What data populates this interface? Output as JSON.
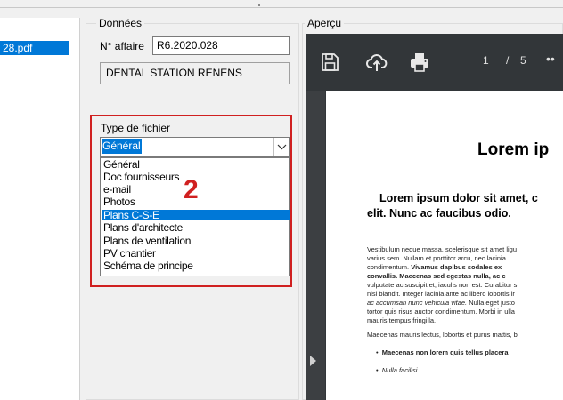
{
  "file_list": {
    "items": [
      "28.pdf"
    ]
  },
  "donnees": {
    "group_label": "Données",
    "affaire_label": "N° affaire",
    "affaire_value": "R6.2020.028",
    "client_name": "DENTAL STATION RENENS",
    "type_label": "Type de fichier",
    "type_selected": "Général",
    "type_options": [
      "Général",
      "Doc fournisseurs",
      "e-mail",
      "Photos",
      "Plans C-S-E",
      "Plans d'architecte",
      "Plans de ventilation",
      "PV chantier",
      "Schéma de principe"
    ],
    "highlighted_option_index": 4,
    "annotation_number": "2",
    "highlight_color": "#d02020"
  },
  "apercu": {
    "group_label": "Aperçu",
    "toolbar": {
      "save_icon": "save-icon",
      "upload_icon": "cloud-upload-icon",
      "print_icon": "print-icon",
      "page_current": "1",
      "page_separator": "/",
      "page_total": "5",
      "more_label": "••"
    },
    "page": {
      "title": "Lorem ip",
      "lead_lines": [
        "Lorem ipsum dolor sit amet, c",
        "elit. Nunc ac faucibus odio."
      ],
      "p1_lines": [
        "Vestibulum neque massa, scelerisque sit amet ligu",
        "varius sem. Nullam et porttitor arcu, nec lacinia",
        "condimentum.",
        "Vivamus dapibus sodales ex",
        "convallis. Maecenas sed egestas nulla, ac c",
        "vulputate ac suscipit et, iaculis non est. Curabitur s",
        "nisl blandit. Integer lacinia ante ac libero lobortis ir",
        "ac accumsan nunc vehicula vitae.",
        " Nulla eget justo",
        "tortor quis risus auctor condimentum. Morbi in ulla",
        "mauris tempus fringilla."
      ],
      "p2_line": "Maecenas mauris lectus, lobortis et purus mattis, b",
      "bullets": [
        "Maecenas non lorem quis tellus placera",
        "Nulla facilisi."
      ]
    }
  }
}
